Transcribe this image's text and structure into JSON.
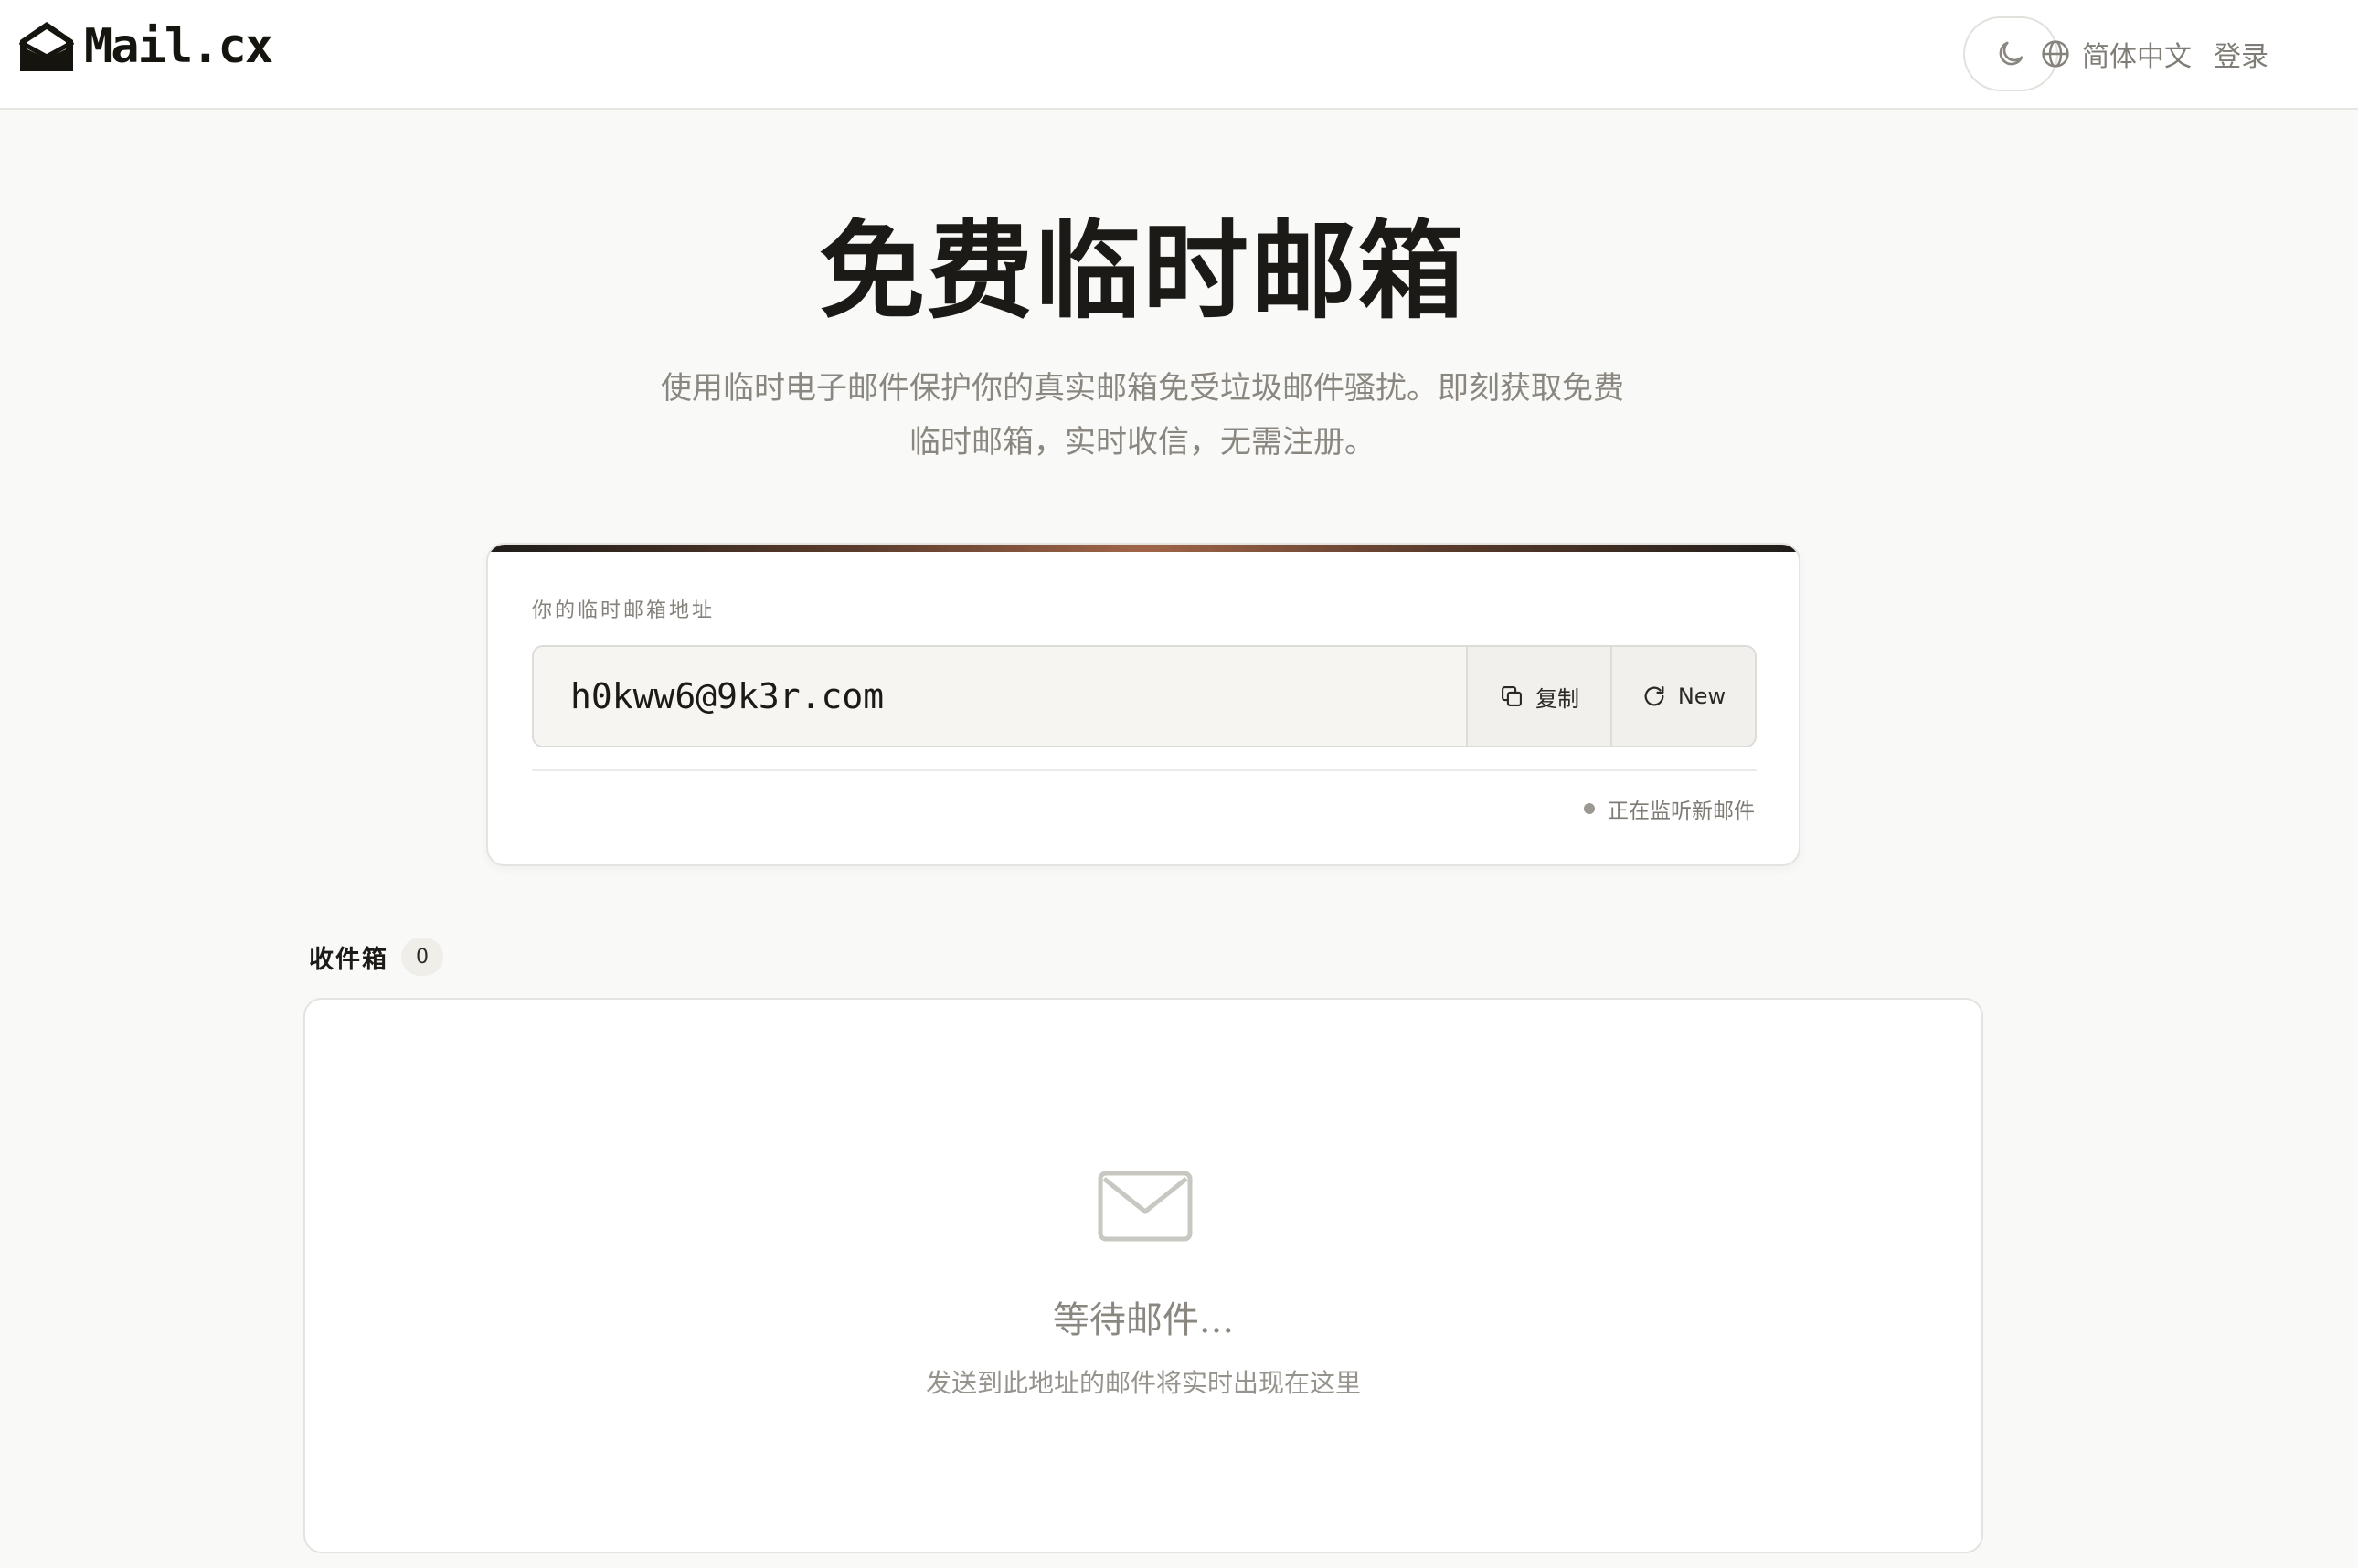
{
  "header": {
    "brand_name": "Mail.cx",
    "language_label": "简体中文",
    "login_label": "登录"
  },
  "hero": {
    "title": "免费临时邮箱",
    "subtitle_line1": "使用临时电子邮件保护你的真实邮箱免受垃圾邮件骚扰。即刻获取免费",
    "subtitle_line2": "临时邮箱，实时收信，无需注册。"
  },
  "address_card": {
    "label": "你的临时邮箱地址",
    "email": "h0kww6@9k3r.com",
    "copy_label": "复制",
    "new_label": "New",
    "status_text": "正在监听新邮件"
  },
  "inbox": {
    "title": "收件箱",
    "count": "0",
    "empty_title": "等待邮件...",
    "empty_subtitle": "发送到此地址的邮件将实时出现在这里"
  },
  "colors": {
    "page_background": "#f9f9f7",
    "accent_gradient": [
      "#1f1c18",
      "#a06548"
    ],
    "muted_text": "#8a8780"
  },
  "icons": [
    "mail-logo-icon",
    "moon-icon",
    "globe-icon",
    "copy-icon",
    "refresh-icon",
    "envelope-icon"
  ]
}
